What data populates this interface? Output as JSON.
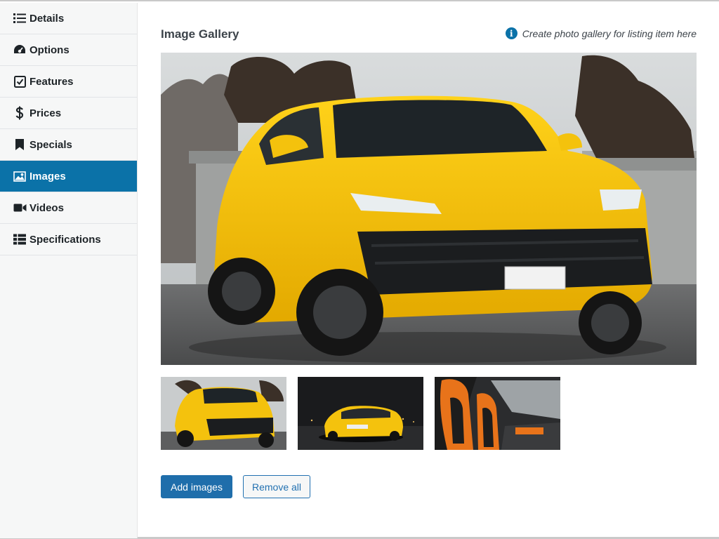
{
  "sidebar": {
    "items": [
      {
        "label": "Details",
        "icon": "list-icon"
      },
      {
        "label": "Options",
        "icon": "dashboard-icon"
      },
      {
        "label": "Features",
        "icon": "checkbox-icon"
      },
      {
        "label": "Prices",
        "icon": "dollar-icon"
      },
      {
        "label": "Specials",
        "icon": "bookmark-icon"
      },
      {
        "label": "Images",
        "icon": "image-icon",
        "active": true
      },
      {
        "label": "Videos",
        "icon": "video-icon"
      },
      {
        "label": "Specifications",
        "icon": "table-icon"
      }
    ]
  },
  "gallery": {
    "title": "Image Gallery",
    "hint": "Create photo gallery for listing item here"
  },
  "actions": {
    "add_label": "Add images",
    "remove_label": "Remove all"
  },
  "colors": {
    "accent": "#0b72a8",
    "car_yellow": "#f4c20d"
  }
}
